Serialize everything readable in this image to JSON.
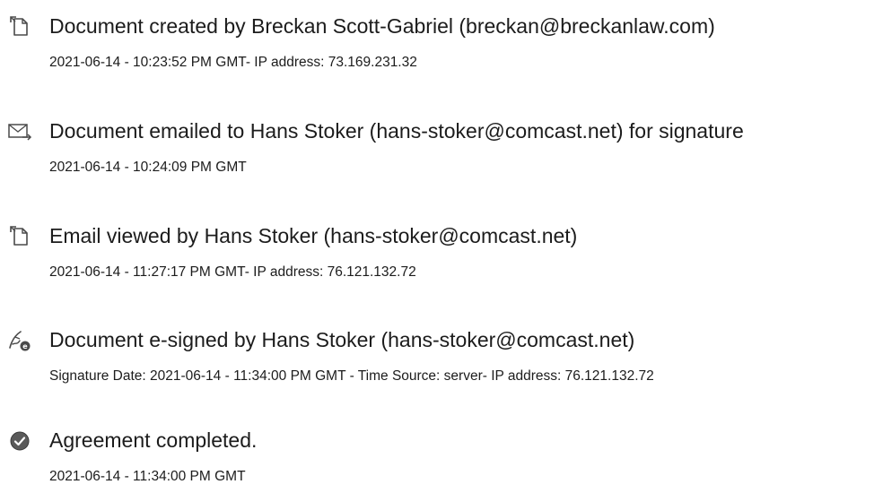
{
  "events": [
    {
      "icon": "document-icon",
      "title": "Document created by Breckan Scott-Gabriel (breckan@breckanlaw.com)",
      "detail": "2021-06-14 - 10:23:52 PM GMT- IP address: 73.169.231.32"
    },
    {
      "icon": "email-sent-icon",
      "title": "Document emailed to Hans Stoker (hans-stoker@comcast.net) for signature",
      "detail": "2021-06-14 - 10:24:09 PM GMT"
    },
    {
      "icon": "document-icon",
      "title": "Email viewed by Hans Stoker (hans-stoker@comcast.net)",
      "detail": "2021-06-14 - 11:27:17 PM GMT- IP address: 76.121.132.72"
    },
    {
      "icon": "esign-pen-icon",
      "title": "Document e-signed by Hans Stoker (hans-stoker@comcast.net)",
      "detail": "Signature Date: 2021-06-14 - 11:34:00 PM GMT - Time Source: server- IP address: 76.121.132.72"
    },
    {
      "icon": "checkmark-circle-icon",
      "title": "Agreement completed.",
      "detail": "2021-06-14 - 11:34:00 PM GMT"
    }
  ],
  "colors": {
    "text": "#1c1c1c",
    "icon": "#4a4a4a"
  }
}
